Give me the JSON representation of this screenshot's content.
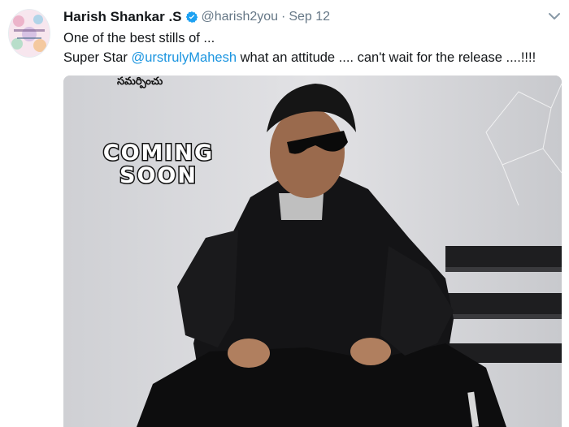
{
  "tweet": {
    "author_name": "Harish Shankar .S",
    "handle": "@harish2you",
    "separator": "·",
    "timestamp": "Sep 12",
    "line1": "One of the best stills of ...",
    "line2_prefix": "Super Star ",
    "mention": "@urstrulyMahesh",
    "line2_suffix": " what an attitude .... can't wait for the release ....!!!!",
    "avatar_icon": "avatar-collage",
    "verified_icon": "verified-badge-icon",
    "menu_icon": "chevron-down-icon"
  },
  "media": {
    "telugu_caption": "సమర్పించు",
    "poster_line1": "COMING",
    "poster_line2": "SOON"
  },
  "colors": {
    "text": "#14171a",
    "secondary": "#657786",
    "link": "#1b95e0",
    "verified": "#1da1f2"
  }
}
